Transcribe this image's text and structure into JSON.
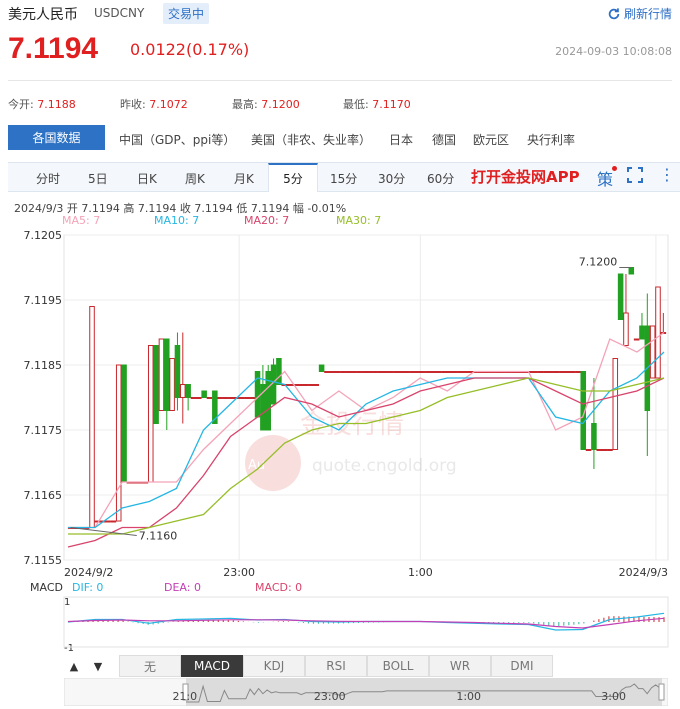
{
  "header": {
    "name": "美元人民币",
    "code": "USDCNY",
    "status": "交易中",
    "refresh_label": "刷新行情",
    "price": "7.1194",
    "change": "0.0122(0.17%)",
    "timestamp": "2024-09-03 10:08:08"
  },
  "stats": [
    {
      "label": "今开:",
      "value": "7.1188"
    },
    {
      "label": "昨收:",
      "value": "7.1072"
    },
    {
      "label": "最高:",
      "value": "7.1200"
    },
    {
      "label": "最低:",
      "value": "7.1170"
    }
  ],
  "tabs1": {
    "active": "各国数据",
    "items": [
      "中国（GDP、ppi等）",
      "美国（非农、失业率）",
      "日本",
      "德国",
      "欧元区",
      "央行利率"
    ]
  },
  "tabs2": {
    "items": [
      "分时",
      "5日",
      "日K",
      "周K",
      "月K",
      "5分",
      "15分",
      "30分",
      "60分"
    ],
    "active_index": 5,
    "app_link": "打开金投网APP",
    "ce_label": "策"
  },
  "info": {
    "ohlc": "2024/9/3  开 7.1194  高 7.1194  收 7.1194  低 7.1194  幅 -0.01%",
    "ma5": "MA5: 7",
    "ma10": "MA10: 7",
    "ma20": "MA20: 7",
    "ma30": "MA30: 7"
  },
  "watermark": {
    "brand": "金投行情",
    "url": "quote.cngold.org"
  },
  "macd": {
    "label": "MACD",
    "dif": "DIF: 0",
    "dea": "DEA: 0",
    "macd": "MACD: 0",
    "ytop": "1",
    "ybottom": "-1"
  },
  "toolbar": {
    "prev": "▲",
    "next": "▼",
    "indicators": [
      "无",
      "MACD",
      "KDJ",
      "RSI",
      "BOLL",
      "WR",
      "DMI"
    ],
    "active": "MACD"
  },
  "navigator": {
    "labels": [
      {
        "text": "21:0",
        "t": 0.2
      },
      {
        "text": "23:00",
        "t": 0.44
      },
      {
        "text": "1:00",
        "t": 0.67
      },
      {
        "text": "3:00",
        "t": 0.91
      }
    ]
  },
  "chart_data": {
    "type": "candlestick",
    "ylim": [
      7.1155,
      7.1205
    ],
    "y_ticks": [
      "7.1205",
      "7.1195",
      "7.1185",
      "7.1175",
      "7.1165",
      "7.1155"
    ],
    "x_labels": [
      {
        "text": "2024/9/2",
        "t": 0.0
      },
      {
        "text": "23:00",
        "t": 0.29
      },
      {
        "text": "1:00",
        "t": 0.59
      },
      {
        "text": "2024/9/3",
        "t": 1.0
      }
    ],
    "annotations": [
      {
        "text": "7.1200",
        "value": 7.12
      },
      {
        "text": "7.1160",
        "value": 7.116
      }
    ],
    "colors": {
      "up": "#c8282d",
      "down": "#22a022",
      "ma5": "#f4a3b8",
      "ma10": "#25b6e4",
      "ma20": "#d8446c",
      "ma30": "#96be28"
    },
    "candles": [
      {
        "o": 7.116,
        "h": 7.116,
        "c": 7.116,
        "l": 7.116
      },
      {
        "o": 7.116,
        "h": 7.116,
        "c": 7.116,
        "l": 7.116
      },
      {
        "o": 7.116,
        "h": 7.116,
        "c": 7.116,
        "l": 7.116
      },
      {
        "o": 7.116,
        "h": 7.116,
        "c": 7.116,
        "l": 7.116
      },
      {
        "o": 7.116,
        "h": 7.1194,
        "c": 7.1194,
        "l": 7.116
      },
      {
        "o": 7.1161,
        "h": 7.1161,
        "c": 7.1161,
        "l": 7.1161
      },
      {
        "o": 7.1161,
        "h": 7.1161,
        "c": 7.1161,
        "l": 7.1161
      },
      {
        "o": 7.1161,
        "h": 7.1161,
        "c": 7.1161,
        "l": 7.1161
      },
      {
        "o": 7.1161,
        "h": 7.1161,
        "c": 7.1161,
        "l": 7.1161
      },
      {
        "o": 7.1161,
        "h": 7.1185,
        "c": 7.1185,
        "l": 7.1161
      },
      {
        "o": 7.1185,
        "h": 7.1185,
        "c": 7.1167,
        "l": 7.1167
      },
      {
        "o": 7.1167,
        "h": 7.1167,
        "c": 7.1167,
        "l": 7.1167
      },
      {
        "o": 7.1167,
        "h": 7.1167,
        "c": 7.1167,
        "l": 7.1167
      },
      {
        "o": 7.1167,
        "h": 7.1167,
        "c": 7.1167,
        "l": 7.1167
      },
      {
        "o": 7.1167,
        "h": 7.1167,
        "c": 7.1167,
        "l": 7.1167
      },
      {
        "o": 7.1167,
        "h": 7.1188,
        "c": 7.1188,
        "l": 7.1167
      },
      {
        "o": 7.1188,
        "h": 7.1188,
        "c": 7.1176,
        "l": 7.1176
      },
      {
        "o": 7.1178,
        "h": 7.1189,
        "c": 7.1189,
        "l": 7.1178
      },
      {
        "o": 7.1189,
        "h": 7.1189,
        "c": 7.1178,
        "l": 7.1175
      },
      {
        "o": 7.1178,
        "h": 7.1186,
        "c": 7.1186,
        "l": 7.1178
      },
      {
        "o": 7.1188,
        "h": 7.119,
        "c": 7.118,
        "l": 7.1178
      },
      {
        "o": 7.118,
        "h": 7.119,
        "c": 7.1182,
        "l": 7.1176
      },
      {
        "o": 7.1182,
        "h": 7.1182,
        "c": 7.118,
        "l": 7.1178
      },
      {
        "o": 7.118,
        "h": 7.118,
        "c": 7.118,
        "l": 7.118
      },
      {
        "o": 7.118,
        "h": 7.118,
        "c": 7.118,
        "l": 7.118
      },
      {
        "o": 7.1181,
        "h": 7.1181,
        "c": 7.118,
        "l": 7.118
      },
      {
        "o": 7.118,
        "h": 7.118,
        "c": 7.118,
        "l": 7.118
      },
      {
        "o": 7.1181,
        "h": 7.1181,
        "c": 7.1176,
        "l": 7.1176
      },
      {
        "o": 7.118,
        "h": 7.118,
        "c": 7.118,
        "l": 7.118
      },
      {
        "o": 7.118,
        "h": 7.118,
        "c": 7.118,
        "l": 7.118
      },
      {
        "o": 7.118,
        "h": 7.118,
        "c": 7.118,
        "l": 7.118
      },
      {
        "o": 7.118,
        "h": 7.118,
        "c": 7.118,
        "l": 7.118
      },
      {
        "o": 7.118,
        "h": 7.118,
        "c": 7.118,
        "l": 7.118
      },
      {
        "o": 7.118,
        "h": 7.118,
        "c": 7.118,
        "l": 7.118
      },
      {
        "o": 7.118,
        "h": 7.118,
        "c": 7.118,
        "l": 7.118
      },
      {
        "o": 7.1184,
        "h": 7.1184,
        "c": 7.1177,
        "l": 7.1177
      },
      {
        "o": 7.1182,
        "h": 7.1185,
        "c": 7.1175,
        "l": 7.1175
      },
      {
        "o": 7.1184,
        "h": 7.1185,
        "c": 7.1175,
        "l": 7.1175
      },
      {
        "o": 7.1185,
        "h": 7.1186,
        "c": 7.1179,
        "l": 7.1179
      },
      {
        "o": 7.1186,
        "h": 7.1186,
        "c": 7.1182,
        "l": 7.1182
      },
      {
        "o": 7.1182,
        "h": 7.1182,
        "c": 7.1182,
        "l": 7.1182
      },
      {
        "o": 7.1182,
        "h": 7.1182,
        "c": 7.1182,
        "l": 7.1182
      },
      {
        "o": 7.1182,
        "h": 7.1182,
        "c": 7.1182,
        "l": 7.1182
      },
      {
        "o": 7.1182,
        "h": 7.1182,
        "c": 7.1182,
        "l": 7.1182
      },
      {
        "o": 7.1182,
        "h": 7.1182,
        "c": 7.1182,
        "l": 7.1182
      },
      {
        "o": 7.1182,
        "h": 7.1182,
        "c": 7.1182,
        "l": 7.1182
      },
      {
        "o": 7.1182,
        "h": 7.1182,
        "c": 7.1182,
        "l": 7.1182
      },
      {
        "o": 7.1185,
        "h": 7.1185,
        "c": 7.1184,
        "l": 7.1184
      },
      {
        "o": 7.1184,
        "h": 7.1184,
        "c": 7.1184,
        "l": 7.1184
      },
      {
        "o": 7.1184,
        "h": 7.1184,
        "c": 7.1184,
        "l": 7.1184
      },
      {
        "o": 7.1184,
        "h": 7.1184,
        "c": 7.1184,
        "l": 7.1184
      },
      {
        "o": 7.1184,
        "h": 7.1184,
        "c": 7.1184,
        "l": 7.1184
      },
      {
        "o": 7.1184,
        "h": 7.1184,
        "c": 7.1184,
        "l": 7.1184
      },
      {
        "o": 7.1184,
        "h": 7.1184,
        "c": 7.1184,
        "l": 7.1184
      },
      {
        "o": 7.1184,
        "h": 7.1184,
        "c": 7.1184,
        "l": 7.1184
      },
      {
        "o": 7.1184,
        "h": 7.1184,
        "c": 7.1184,
        "l": 7.1184
      },
      {
        "o": 7.1184,
        "h": 7.1184,
        "c": 7.1184,
        "l": 7.1184
      },
      {
        "o": 7.1184,
        "h": 7.1184,
        "c": 7.1184,
        "l": 7.1184
      },
      {
        "o": 7.1184,
        "h": 7.1184,
        "c": 7.1184,
        "l": 7.1184
      },
      {
        "o": 7.1184,
        "h": 7.1184,
        "c": 7.1184,
        "l": 7.1184
      },
      {
        "o": 7.1184,
        "h": 7.1184,
        "c": 7.1184,
        "l": 7.1184
      },
      {
        "o": 7.1184,
        "h": 7.1184,
        "c": 7.1184,
        "l": 7.1184
      },
      {
        "o": 7.1184,
        "h": 7.1184,
        "c": 7.1184,
        "l": 7.1184
      },
      {
        "o": 7.1184,
        "h": 7.1184,
        "c": 7.1184,
        "l": 7.1184
      },
      {
        "o": 7.1184,
        "h": 7.1184,
        "c": 7.1184,
        "l": 7.1184
      },
      {
        "o": 7.1184,
        "h": 7.1184,
        "c": 7.1184,
        "l": 7.1184
      },
      {
        "o": 7.1184,
        "h": 7.1184,
        "c": 7.1184,
        "l": 7.1184
      },
      {
        "o": 7.1184,
        "h": 7.1184,
        "c": 7.1184,
        "l": 7.1184
      },
      {
        "o": 7.1184,
        "h": 7.1184,
        "c": 7.1184,
        "l": 7.1184
      },
      {
        "o": 7.1184,
        "h": 7.1184,
        "c": 7.1184,
        "l": 7.1184
      },
      {
        "o": 7.1184,
        "h": 7.1184,
        "c": 7.1184,
        "l": 7.1184
      },
      {
        "o": 7.1184,
        "h": 7.1184,
        "c": 7.1184,
        "l": 7.1184
      },
      {
        "o": 7.1184,
        "h": 7.1184,
        "c": 7.1184,
        "l": 7.1184
      },
      {
        "o": 7.1184,
        "h": 7.1184,
        "c": 7.1184,
        "l": 7.1184
      },
      {
        "o": 7.1184,
        "h": 7.1184,
        "c": 7.1184,
        "l": 7.1184
      },
      {
        "o": 7.1184,
        "h": 7.1184,
        "c": 7.1184,
        "l": 7.1184
      },
      {
        "o": 7.1184,
        "h": 7.1184,
        "c": 7.1184,
        "l": 7.1184
      },
      {
        "o": 7.1184,
        "h": 7.1184,
        "c": 7.1184,
        "l": 7.1184
      },
      {
        "o": 7.1184,
        "h": 7.1184,
        "c": 7.1184,
        "l": 7.1184
      },
      {
        "o": 7.1184,
        "h": 7.1184,
        "c": 7.1184,
        "l": 7.1184
      },
      {
        "o": 7.1184,
        "h": 7.1184,
        "c": 7.1184,
        "l": 7.1184
      },
      {
        "o": 7.1184,
        "h": 7.1184,
        "c": 7.1184,
        "l": 7.1184
      },
      {
        "o": 7.1184,
        "h": 7.1184,
        "c": 7.1184,
        "l": 7.1184
      },
      {
        "o": 7.1184,
        "h": 7.1184,
        "c": 7.1184,
        "l": 7.1184
      },
      {
        "o": 7.1184,
        "h": 7.1184,
        "c": 7.1184,
        "l": 7.1184
      },
      {
        "o": 7.1184,
        "h": 7.1184,
        "c": 7.1184,
        "l": 7.1184
      },
      {
        "o": 7.1184,
        "h": 7.1184,
        "c": 7.1184,
        "l": 7.1184
      },
      {
        "o": 7.1184,
        "h": 7.1184,
        "c": 7.1184,
        "l": 7.1184
      },
      {
        "o": 7.1184,
        "h": 7.1184,
        "c": 7.1184,
        "l": 7.1184
      },
      {
        "o": 7.1184,
        "h": 7.1184,
        "c": 7.1184,
        "l": 7.1184
      },
      {
        "o": 7.1184,
        "h": 7.1184,
        "c": 7.1184,
        "l": 7.1184
      },
      {
        "o": 7.1184,
        "h": 7.1184,
        "c": 7.1184,
        "l": 7.1184
      },
      {
        "o": 7.1184,
        "h": 7.1184,
        "c": 7.1184,
        "l": 7.1184
      },
      {
        "o": 7.1184,
        "h": 7.1184,
        "c": 7.1184,
        "l": 7.1184
      },
      {
        "o": 7.1184,
        "h": 7.1184,
        "c": 7.1184,
        "l": 7.1184
      },
      {
        "o": 7.1184,
        "h": 7.1184,
        "c": 7.1184,
        "l": 7.1184
      },
      {
        "o": 7.1184,
        "h": 7.1184,
        "c": 7.1172,
        "l": 7.1172
      },
      {
        "o": 7.1172,
        "h": 7.1172,
        "c": 7.1172,
        "l": 7.1172
      },
      {
        "o": 7.1176,
        "h": 7.1183,
        "c": 7.1172,
        "l": 7.1169
      },
      {
        "o": 7.1172,
        "h": 7.1172,
        "c": 7.1172,
        "l": 7.1172
      },
      {
        "o": 7.1172,
        "h": 7.1172,
        "c": 7.1172,
        "l": 7.1172
      },
      {
        "o": 7.1172,
        "h": 7.1172,
        "c": 7.1172,
        "l": 7.1172
      },
      {
        "o": 7.1172,
        "h": 7.1186,
        "c": 7.1186,
        "l": 7.1172
      },
      {
        "o": 7.1199,
        "h": 7.1199,
        "c": 7.1192,
        "l": 7.1192
      },
      {
        "o": 7.1188,
        "h": 7.1199,
        "c": 7.1193,
        "l": 7.1188
      },
      {
        "o": 7.12,
        "h": 7.12,
        "c": 7.1199,
        "l": 7.1199
      },
      {
        "o": 7.1189,
        "h": 7.1189,
        "c": 7.1189,
        "l": 7.1189
      },
      {
        "o": 7.1191,
        "h": 7.1193,
        "c": 7.1189,
        "l": 7.1189
      },
      {
        "o": 7.1191,
        "h": 7.1196,
        "c": 7.1178,
        "l": 7.1171
      },
      {
        "o": 7.1183,
        "h": 7.1191,
        "c": 7.1191,
        "l": 7.1183
      },
      {
        "o": 7.1183,
        "h": 7.1197,
        "c": 7.1197,
        "l": 7.1183
      },
      {
        "o": 7.119,
        "h": 7.1193,
        "c": 7.119,
        "l": 7.119
      }
    ],
    "series": [
      {
        "name": "MA5",
        "values": [
          7.116,
          7.116,
          7.1167,
          7.1167,
          7.1167,
          7.1172,
          7.1176,
          7.118,
          7.1184,
          7.1178,
          7.1181,
          7.1178,
          7.118,
          7.1183,
          7.1181,
          7.1184,
          7.1184,
          7.1184,
          7.1175,
          7.1177,
          7.1189,
          7.1187,
          7.119
        ]
      },
      {
        "name": "MA10",
        "values": [
          7.116,
          7.116,
          7.1163,
          7.1164,
          7.1166,
          7.1175,
          7.1179,
          7.1183,
          7.1182,
          7.1177,
          7.1175,
          7.1179,
          7.1181,
          7.1182,
          7.1183,
          7.1183,
          7.1183,
          7.1183,
          7.1177,
          7.1176,
          7.1181,
          7.1183,
          7.1187
        ]
      },
      {
        "name": "MA20",
        "values": [
          7.1157,
          7.1158,
          7.116,
          7.116,
          7.1163,
          7.1168,
          7.1174,
          7.1177,
          7.118,
          7.1179,
          7.1177,
          7.1178,
          7.1179,
          7.1181,
          7.1182,
          7.1183,
          7.1183,
          7.1183,
          7.1181,
          7.1179,
          7.118,
          7.1181,
          7.1183
        ]
      },
      {
        "name": "MA30",
        "values": [
          7.1159,
          7.1159,
          7.1159,
          7.116,
          7.1161,
          7.1162,
          7.1166,
          7.1169,
          7.1173,
          7.1175,
          7.1176,
          7.1176,
          7.1177,
          7.1178,
          7.118,
          7.1181,
          7.1182,
          7.1183,
          7.1182,
          7.1181,
          7.1181,
          7.1182,
          7.1183
        ]
      }
    ],
    "macd_series": {
      "dif": [
        0.0,
        0.1,
        0.1,
        -0.05,
        0.1,
        0.12,
        0.15,
        0.08,
        0.1,
        0.02,
        0.0,
        0.02,
        0.02,
        0.02,
        -0.02,
        -0.05,
        -0.08,
        -0.1,
        -0.32,
        -0.3,
        0.1,
        0.2,
        0.35
      ],
      "dea": [
        0.02,
        0.06,
        0.08,
        0.05,
        0.05,
        0.07,
        0.09,
        0.09,
        0.08,
        0.05,
        0.03,
        0.02,
        0.02,
        0.02,
        0.0,
        -0.02,
        -0.05,
        -0.08,
        -0.18,
        -0.24,
        -0.1,
        0.05,
        0.15
      ],
      "bars": [
        0.0,
        0.15,
        0.1,
        -0.2,
        0.05,
        0.1,
        0.12,
        -0.05,
        0.06,
        -0.12,
        -0.1,
        -0.05,
        0.0,
        0.0,
        -0.06,
        -0.08,
        -0.06,
        -0.05,
        -0.3,
        -0.12,
        0.4,
        0.35,
        0.32
      ]
    }
  }
}
